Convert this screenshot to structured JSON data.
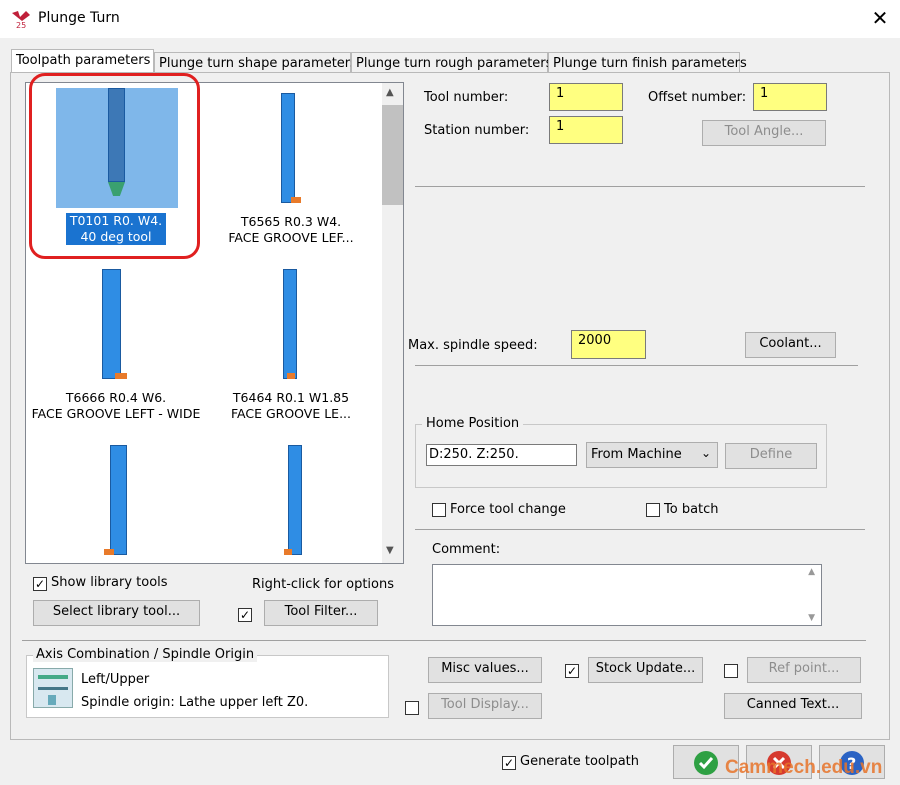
{
  "window": {
    "title": "Plunge Turn",
    "close_glyph": "✕"
  },
  "tabs": [
    "Toolpath parameters",
    "Plunge turn shape parameters",
    "Plunge turn rough parameters",
    "Plunge turn finish parameters"
  ],
  "tools": [
    {
      "line1": "T0101 R0. W4.",
      "line2": "40 deg tool",
      "selected": true
    },
    {
      "line1": "T6565 R0.3 W4.",
      "line2": "FACE GROOVE LEF..."
    },
    {
      "line1": "T6666 R0.4 W6.",
      "line2": "FACE GROOVE LEFT - WIDE"
    },
    {
      "line1": "T6464 R0.1 W1.85",
      "line2": "FACE GROOVE LE..."
    }
  ],
  "scroll": {
    "up": "▲",
    "down": "▼"
  },
  "fields": {
    "tool_number_label": "Tool number:",
    "tool_number": "1",
    "offset_number_label": "Offset number:",
    "offset_number": "1",
    "station_number_label": "Station number:",
    "station_number": "1",
    "tool_angle_btn": "Tool Angle...",
    "max_spindle_label": "Max. spindle speed:",
    "max_spindle": "2000",
    "coolant_btn": "Coolant..."
  },
  "home": {
    "group_label": "Home Position",
    "value": "D:250.  Z:250.",
    "select": "From Machine",
    "define_btn": "Define"
  },
  "checks": {
    "force_tool_change": "Force tool change",
    "to_batch": "To batch"
  },
  "comment_label": "Comment:",
  "library": {
    "show_label": "Show library tools",
    "right_click": "Right-click for options",
    "select_btn": "Select library tool...",
    "filter_btn": "Tool Filter..."
  },
  "axis": {
    "group_label": "Axis Combination / Spindle Origin",
    "combo": "Left/Upper",
    "origin": "Spindle origin: Lathe upper left  Z0."
  },
  "buttons": {
    "misc_values": "Misc values...",
    "stock_update": "Stock Update...",
    "ref_point": "Ref point...",
    "tool_display": "Tool Display...",
    "canned_text": "Canned Text...",
    "generate_toolpath": "Generate toolpath"
  },
  "watermark": "Cammech.edu.vn",
  "colors": {
    "highlight_red": "#e02020",
    "field_yellow": "#ffff80",
    "tool_blue": "#2f8de4",
    "ok_green": "#2ea043",
    "cancel_red": "#d63a2f",
    "help_blue": "#2b63c4"
  }
}
